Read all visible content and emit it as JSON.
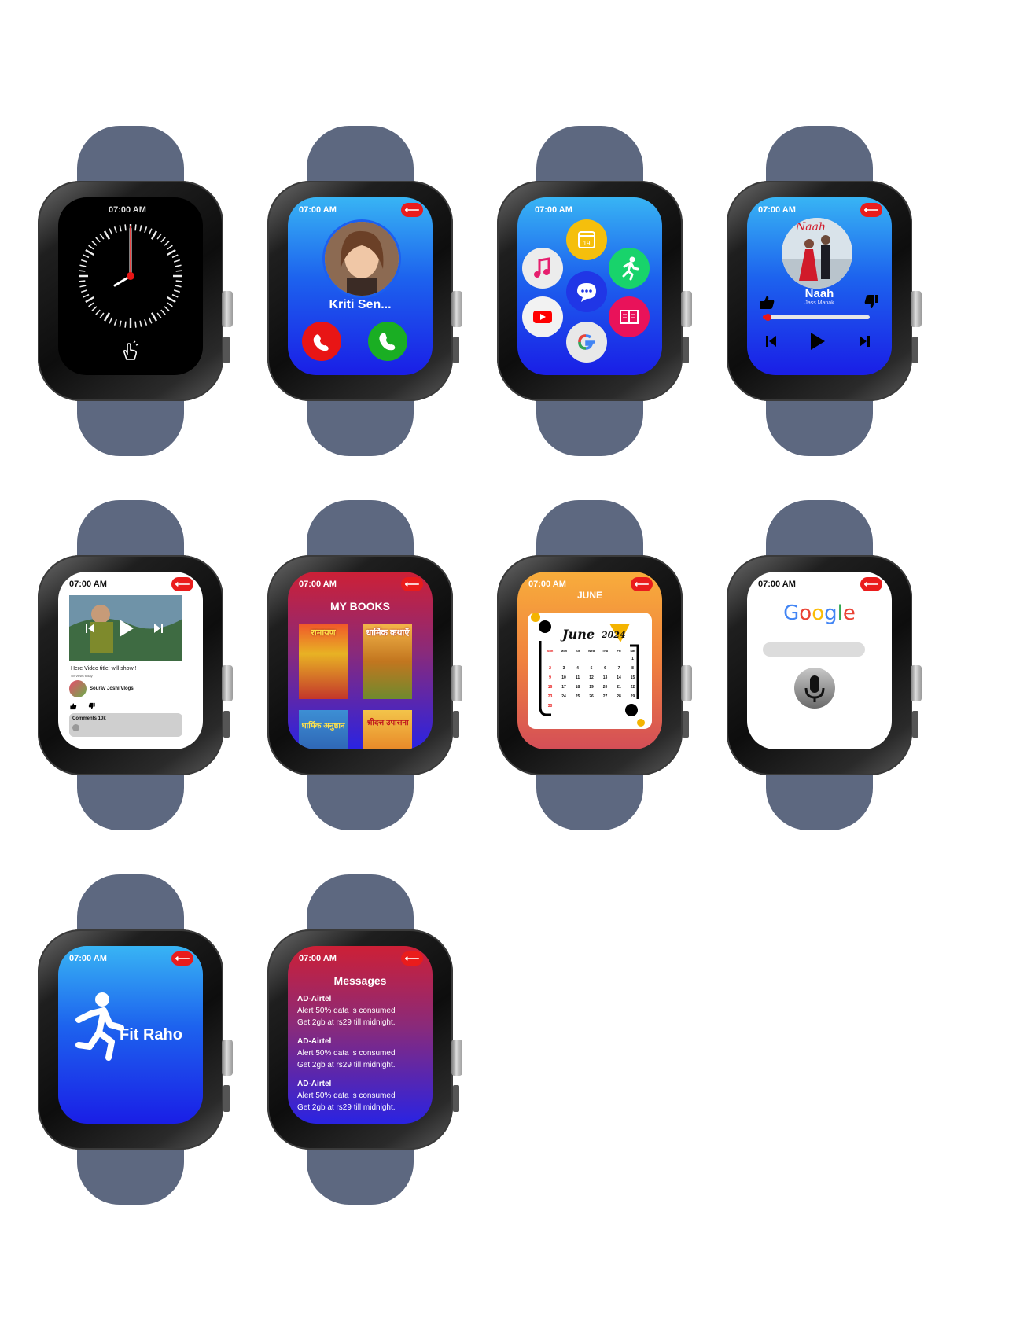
{
  "time": "07:00 AM",
  "call": {
    "caller": "Kriti Sen..."
  },
  "music": {
    "song": "Naah",
    "artist": "Jass Manak",
    "album_title": "Naah",
    "progress": 0.03
  },
  "video": {
    "title": "Here Video title! will show !",
    "views": "4M views today",
    "channel": "Sourav Joshi Vlogs",
    "comments": "Comments 10k"
  },
  "books": {
    "title": "MY BOOKS",
    "items": [
      "रामायण",
      "धार्मिक कथाएँ",
      "धार्मिक अनुष्ठान",
      "श्रीदत्त उपासना"
    ]
  },
  "calendar": {
    "month_heading": "JUNE",
    "card_month": "June",
    "card_year": "2024",
    "weekdays": [
      "Sun",
      "Mon",
      "Tue",
      "Wed",
      "Thu",
      "Fri",
      "Sat"
    ]
  },
  "google": {
    "logo": "Google"
  },
  "fit": {
    "label": "Fit Raho"
  },
  "messages": {
    "title": "Messages",
    "items": [
      {
        "from": "AD-Airtel",
        "line1": "Alert 50% data is consumed",
        "line2": "Get 2gb at rs29 till midnight."
      },
      {
        "from": "AD-Airtel",
        "line1": "Alert 50% data is consumed",
        "line2": "Get 2gb at rs29 till midnight."
      },
      {
        "from": "AD-Airtel",
        "line1": "Alert 50% data is consumed",
        "line2": "Get 2gb at rs29 till midnight."
      }
    ]
  },
  "colors": {
    "accent_red": "#ea1c1c",
    "accept_green": "#1aae23",
    "strap": "#5d6880"
  }
}
